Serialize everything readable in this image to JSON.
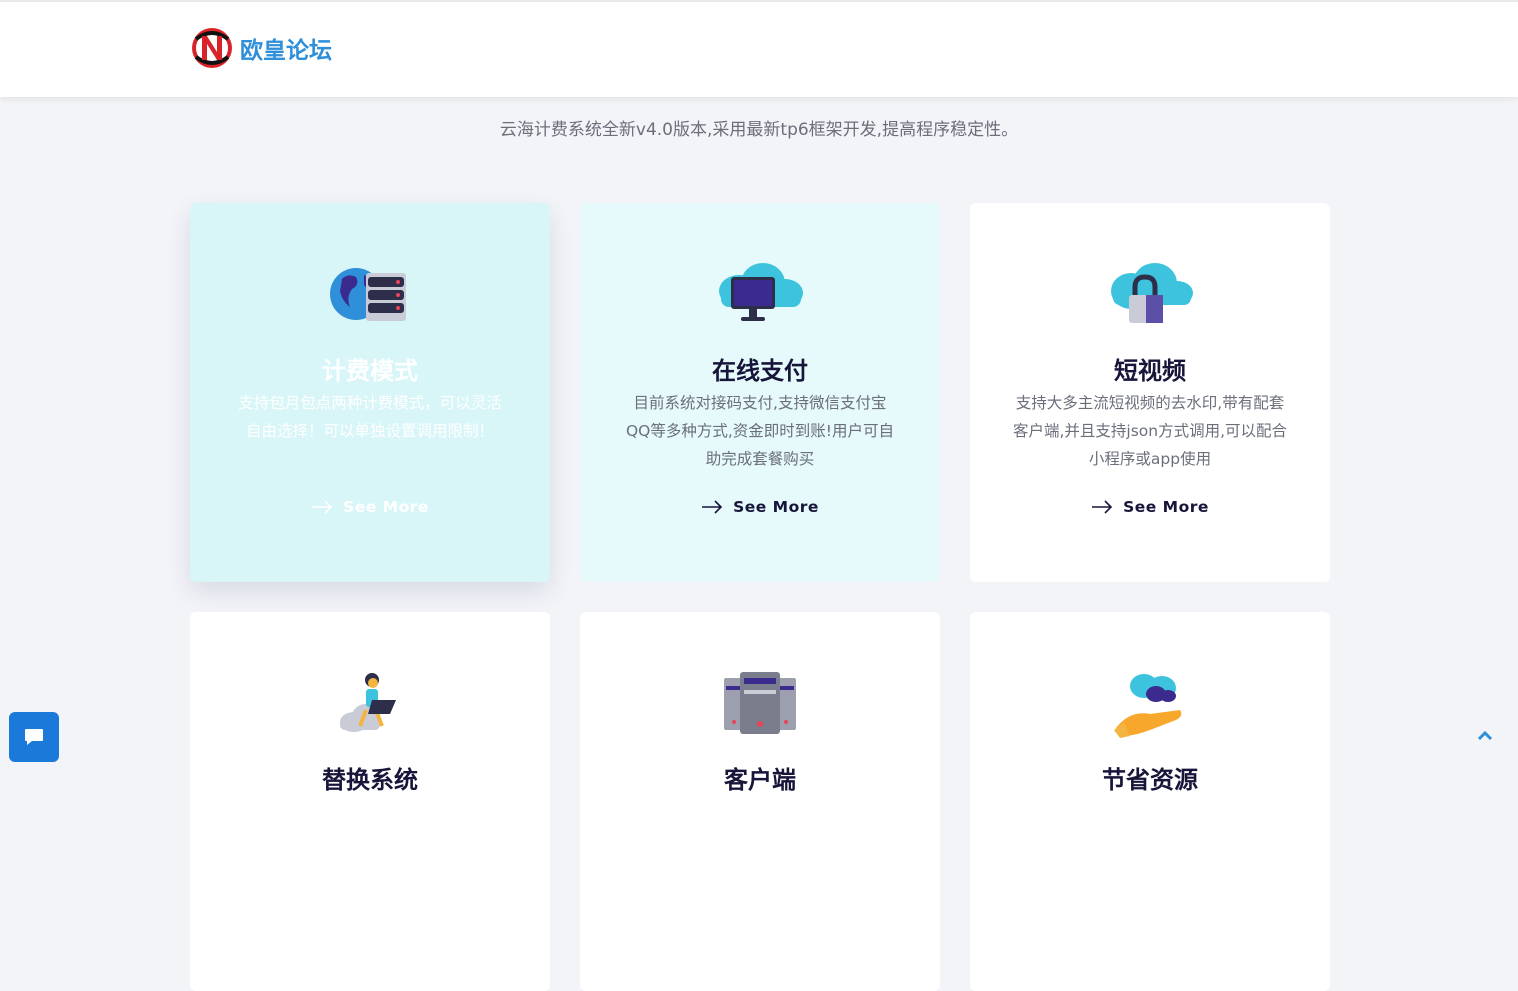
{
  "header": {
    "logo_text": "欧皇论坛"
  },
  "subtitle": "云海计费系统全新v4.0版本,采用最新tp6框架开发,提高程序稳定性。",
  "cards": [
    {
      "title": "计费模式",
      "desc": "支持包月包点两种计费模式，可以灵活自由选择！可以单独设置调用限制！",
      "more": "See More",
      "icon": "globe-server-icon"
    },
    {
      "title": "在线支付",
      "desc": "目前系统对接码支付,支持微信支付宝QQ等多种方式,资金即时到账!用户可自助完成套餐购买",
      "more": "See More",
      "icon": "cloud-monitor-icon"
    },
    {
      "title": "短视频",
      "desc": "支持大多主流短视频的去水印,带有配套客户端,并且支持json方式调用,可以配合小程序或app使用",
      "more": "See More",
      "icon": "cloud-lock-icon"
    },
    {
      "title": "替换系统",
      "icon": "person-laptop-icon"
    },
    {
      "title": "客户端",
      "icon": "server-rack-icon"
    },
    {
      "title": "节省资源",
      "icon": "hand-cloud-icon"
    }
  ],
  "colors": {
    "accent": "#1a79d9",
    "card_active_bg": "#d8f6f8",
    "card_light_bg": "#e6fafc",
    "title": "#17153a"
  }
}
